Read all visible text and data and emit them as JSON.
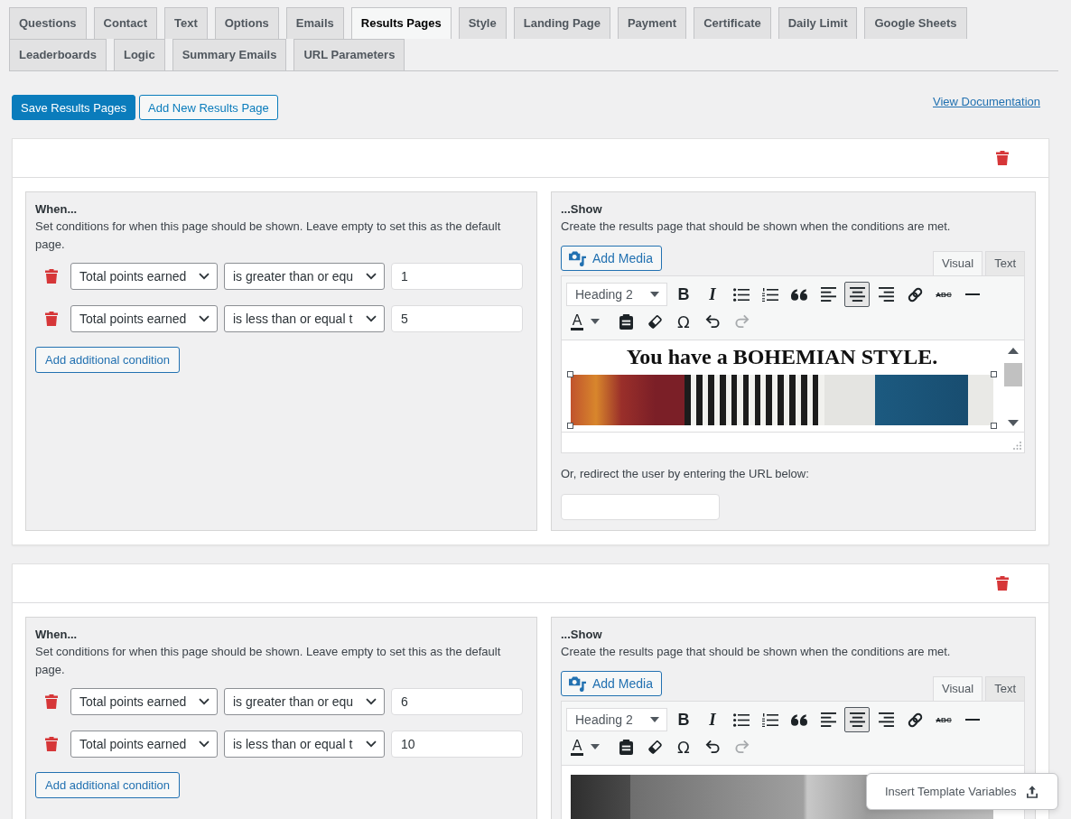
{
  "tabs": [
    {
      "label": "Questions",
      "selected": false
    },
    {
      "label": "Contact",
      "selected": false
    },
    {
      "label": "Text",
      "selected": false
    },
    {
      "label": "Options",
      "selected": false
    },
    {
      "label": "Emails",
      "selected": false
    },
    {
      "label": "Results Pages",
      "selected": true
    },
    {
      "label": "Style",
      "selected": false
    },
    {
      "label": "Landing Page",
      "selected": false
    },
    {
      "label": "Payment",
      "selected": false
    },
    {
      "label": "Certificate",
      "selected": false
    },
    {
      "label": "Daily Limit",
      "selected": false
    },
    {
      "label": "Google Sheets",
      "selected": false
    },
    {
      "label": "Leaderboards",
      "selected": false
    },
    {
      "label": "Logic",
      "selected": false
    },
    {
      "label": "Summary Emails",
      "selected": false
    },
    {
      "label": "URL Parameters",
      "selected": false
    }
  ],
  "actions": {
    "save_button": "Save Results Pages",
    "add_button": "Add New Results Page",
    "documentation_link": "View Documentation"
  },
  "results_pages": [
    {
      "when": {
        "title": "When...",
        "description": "Set conditions for when this page should be shown. Leave empty to set this as the default page.",
        "conditions": [
          {
            "field": "Total points earned",
            "operator": "is greater than or equ",
            "value": "1"
          },
          {
            "field": "Total points earned",
            "operator": "is less than or equal t",
            "value": "5"
          }
        ],
        "add_condition_button": "Add additional condition"
      },
      "show": {
        "title": "...Show",
        "description": "Create the results page that should be shown when the conditions are met.",
        "add_media_button": "Add Media",
        "editor_tabs": [
          {
            "label": "Visual",
            "selected": true
          },
          {
            "label": "Text",
            "selected": false
          }
        ],
        "format_select": "Heading 2",
        "toolbar_rows": [
          [
            {
              "kind": "bold",
              "label": "B",
              "pressed": false,
              "disabled": false
            },
            {
              "kind": "italic",
              "label": "I",
              "pressed": false,
              "disabled": false
            },
            {
              "kind": "bullet_list",
              "pressed": false,
              "disabled": false
            },
            {
              "kind": "numbered_list",
              "pressed": false,
              "disabled": false
            },
            {
              "kind": "blockquote",
              "pressed": false,
              "disabled": false
            },
            {
              "kind": "align_left",
              "pressed": false,
              "disabled": false
            },
            {
              "kind": "align_center",
              "pressed": true,
              "disabled": false
            },
            {
              "kind": "align_right",
              "pressed": false,
              "disabled": false
            },
            {
              "kind": "link",
              "pressed": false,
              "disabled": false
            },
            {
              "kind": "strikethrough",
              "label": "ABC",
              "pressed": false,
              "disabled": false
            },
            {
              "kind": "horizontal_rule",
              "pressed": false,
              "disabled": false
            }
          ],
          [
            {
              "kind": "text_color",
              "label": "A",
              "pressed": false,
              "disabled": false
            },
            {
              "kind": "paste_text",
              "pressed": false,
              "disabled": false
            },
            {
              "kind": "clear_formatting",
              "pressed": false,
              "disabled": false
            },
            {
              "kind": "special_character",
              "label": "Ω",
              "pressed": false,
              "disabled": false
            },
            {
              "kind": "undo",
              "pressed": false,
              "disabled": false
            },
            {
              "kind": "redo",
              "pressed": false,
              "disabled": true
            }
          ]
        ],
        "content": [
          {
            "kind": "heading",
            "text": "You have a BOHEMIAN STYLE."
          },
          {
            "kind": "photo",
            "grayscale": false,
            "selected": true
          }
        ],
        "scrollbar": true,
        "resize_grip": true,
        "redirect": {
          "label": "Or, redirect the user by entering the URL below:"
        }
      }
    },
    {
      "when": {
        "title": "When...",
        "description": "Set conditions for when this page should be shown. Leave empty to set this as the default page.",
        "conditions": [
          {
            "field": "Total points earned",
            "operator": "is greater than or equ",
            "value": "6"
          },
          {
            "field": "Total points earned",
            "operator": "is less than or equal t",
            "value": "10"
          }
        ],
        "add_condition_button": "Add additional condition"
      },
      "show": {
        "title": "...Show",
        "description": "Create the results page that should be shown when the conditions are met.",
        "add_media_button": "Add Media",
        "editor_tabs": [
          {
            "label": "Visual",
            "selected": true
          },
          {
            "label": "Text",
            "selected": false
          }
        ],
        "format_select": "Heading 2",
        "toolbar_rows": [
          [
            {
              "kind": "bold",
              "label": "B",
              "pressed": false,
              "disabled": false
            },
            {
              "kind": "italic",
              "label": "I",
              "pressed": false,
              "disabled": false
            },
            {
              "kind": "bullet_list",
              "pressed": false,
              "disabled": false
            },
            {
              "kind": "numbered_list",
              "pressed": false,
              "disabled": false
            },
            {
              "kind": "blockquote",
              "pressed": false,
              "disabled": false
            },
            {
              "kind": "align_left",
              "pressed": false,
              "disabled": false
            },
            {
              "kind": "align_center",
              "pressed": true,
              "disabled": false
            },
            {
              "kind": "align_right",
              "pressed": false,
              "disabled": false
            },
            {
              "kind": "link",
              "pressed": false,
              "disabled": false
            },
            {
              "kind": "strikethrough",
              "label": "ABC",
              "pressed": false,
              "disabled": false
            },
            {
              "kind": "horizontal_rule",
              "pressed": false,
              "disabled": false
            }
          ],
          [
            {
              "kind": "text_color",
              "label": "A",
              "pressed": false,
              "disabled": false
            },
            {
              "kind": "paste_text",
              "pressed": false,
              "disabled": false
            },
            {
              "kind": "clear_formatting",
              "pressed": false,
              "disabled": false
            },
            {
              "kind": "special_character",
              "label": "Ω",
              "pressed": false,
              "disabled": false
            },
            {
              "kind": "undo",
              "pressed": false,
              "disabled": false
            },
            {
              "kind": "redo",
              "pressed": false,
              "disabled": true
            }
          ]
        ],
        "content": [
          {
            "kind": "photo",
            "grayscale": true,
            "selected": false
          }
        ]
      }
    }
  ],
  "template_variables_button": "Insert Template Variables"
}
